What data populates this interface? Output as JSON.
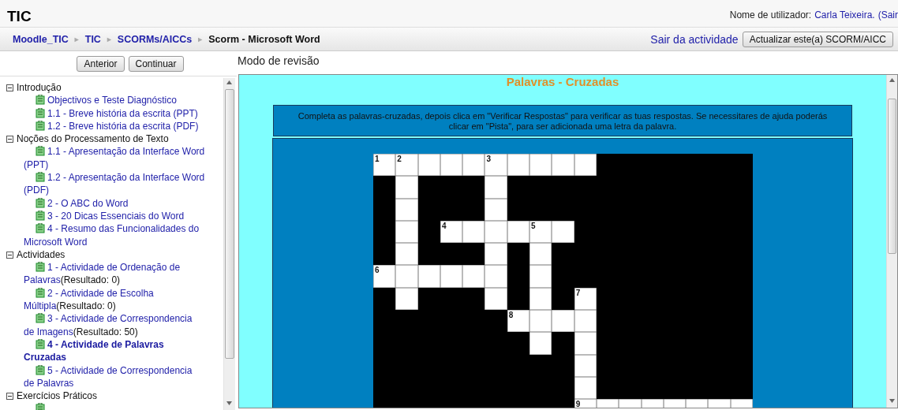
{
  "header": {
    "site_title": "TIC",
    "user_label": "Nome de utilizador:",
    "user_name": "Carla Teixeira.",
    "logout": "(Sair"
  },
  "breadcrumb": [
    {
      "label": "Moodle_TIC",
      "link": true
    },
    {
      "label": "TIC",
      "link": true
    },
    {
      "label": "SCORMs/AICCs",
      "link": true
    },
    {
      "label": "Scorm - Microsoft Word",
      "link": false
    }
  ],
  "breadcrumb_separator": "►",
  "exit_link": "Sair da actividade",
  "update_button": "Actualizar este(a) SCORM/AICC",
  "nav_buttons": [
    "Anterior",
    "Continuar"
  ],
  "mode_label": "Modo de revisão",
  "toc": [
    {
      "title": "Introdução",
      "expanded": true,
      "children": [
        {
          "label": "Objectivos e Teste Diagnóstico",
          "selected": false
        },
        {
          "label": "1.1 - Breve história da escrita (PPT)",
          "selected": false
        },
        {
          "label": "1.2 - Breve história da escrita (PDF)",
          "selected": false
        }
      ]
    },
    {
      "title": "Noções do Processamento de Texto",
      "expanded": true,
      "children": [
        {
          "label": "1.1 - Apresentação da Interface Word (PPT)",
          "selected": false
        },
        {
          "label": "1.2 - Apresentação da Interface Word (PDF)",
          "selected": false
        },
        {
          "label": "2 - O ABC do Word",
          "selected": false
        },
        {
          "label": "3 - 20 Dicas Essenciais do Word",
          "selected": false
        },
        {
          "label": "4 - Resumo das Funcionalidades do Microsoft Word",
          "selected": false
        }
      ]
    },
    {
      "title": "Actividades",
      "expanded": true,
      "children": [
        {
          "label": "1 - Actividade de Ordenação de Palavras",
          "result": "(Resultado: 0)",
          "selected": false
        },
        {
          "label": "2 - Actividade de Escolha Múltipla",
          "result": "(Resultado: 0)",
          "selected": false
        },
        {
          "label": "3 - Actividade de Correspondencia de Imagens",
          "result": "(Resultado: 50)",
          "selected": false
        },
        {
          "label": "4 - Actividade de Palavras Cruzadas",
          "selected": true
        },
        {
          "label": "5 - Actividade de Correspondencia de Palavras",
          "selected": false
        }
      ]
    },
    {
      "title": "Exercícios Práticos",
      "expanded": true,
      "children": [
        {
          "selected": false
        }
      ]
    }
  ],
  "activity": {
    "title": "Palavras - Cruzadas",
    "instructions": "Completa as palavras-cruzadas, depois clica em \"Verificar Respostas\" para verificar as tuas respostas. Se necessitares de ajuda poderás clicar em \"Pista\", para ser adicionada uma letra da palavra.",
    "grid": [
      [
        {
          "kind": "open",
          "number": "1"
        },
        {
          "kind": "open",
          "number": "2"
        },
        {
          "kind": "open"
        },
        {
          "kind": "open"
        },
        {
          "kind": "open"
        },
        {
          "kind": "open",
          "number": "3"
        },
        {
          "kind": "open"
        },
        {
          "kind": "open"
        },
        {
          "kind": "open"
        },
        {
          "kind": "open"
        },
        {
          "kind": "block"
        },
        {
          "kind": "block"
        },
        {
          "kind": "block"
        },
        {
          "kind": "block"
        },
        {
          "kind": "block"
        },
        {
          "kind": "block"
        },
        {
          "kind": "block"
        }
      ],
      [
        {
          "kind": "block"
        },
        {
          "kind": "open"
        },
        {
          "kind": "block"
        },
        {
          "kind": "block"
        },
        {
          "kind": "block"
        },
        {
          "kind": "open"
        },
        {
          "kind": "block"
        },
        {
          "kind": "block"
        },
        {
          "kind": "block"
        },
        {
          "kind": "block"
        },
        {
          "kind": "block"
        },
        {
          "kind": "block"
        },
        {
          "kind": "block"
        },
        {
          "kind": "block"
        },
        {
          "kind": "block"
        },
        {
          "kind": "block"
        },
        {
          "kind": "block"
        }
      ],
      [
        {
          "kind": "block"
        },
        {
          "kind": "open"
        },
        {
          "kind": "block"
        },
        {
          "kind": "block"
        },
        {
          "kind": "block"
        },
        {
          "kind": "open"
        },
        {
          "kind": "block"
        },
        {
          "kind": "block"
        },
        {
          "kind": "block"
        },
        {
          "kind": "block"
        },
        {
          "kind": "block"
        },
        {
          "kind": "block"
        },
        {
          "kind": "block"
        },
        {
          "kind": "block"
        },
        {
          "kind": "block"
        },
        {
          "kind": "block"
        },
        {
          "kind": "block"
        }
      ],
      [
        {
          "kind": "block"
        },
        {
          "kind": "open"
        },
        {
          "kind": "block"
        },
        {
          "kind": "open",
          "number": "4"
        },
        {
          "kind": "open"
        },
        {
          "kind": "open"
        },
        {
          "kind": "open"
        },
        {
          "kind": "open",
          "number": "5"
        },
        {
          "kind": "open"
        },
        {
          "kind": "block"
        },
        {
          "kind": "block"
        },
        {
          "kind": "block"
        },
        {
          "kind": "block"
        },
        {
          "kind": "block"
        },
        {
          "kind": "block"
        },
        {
          "kind": "block"
        },
        {
          "kind": "block"
        }
      ],
      [
        {
          "kind": "block"
        },
        {
          "kind": "open"
        },
        {
          "kind": "block"
        },
        {
          "kind": "block"
        },
        {
          "kind": "block"
        },
        {
          "kind": "open"
        },
        {
          "kind": "block"
        },
        {
          "kind": "open"
        },
        {
          "kind": "block"
        },
        {
          "kind": "block"
        },
        {
          "kind": "block"
        },
        {
          "kind": "block"
        },
        {
          "kind": "block"
        },
        {
          "kind": "block"
        },
        {
          "kind": "block"
        },
        {
          "kind": "block"
        },
        {
          "kind": "block"
        }
      ],
      [
        {
          "kind": "open",
          "number": "6"
        },
        {
          "kind": "open"
        },
        {
          "kind": "open"
        },
        {
          "kind": "open"
        },
        {
          "kind": "open"
        },
        {
          "kind": "open"
        },
        {
          "kind": "block"
        },
        {
          "kind": "open"
        },
        {
          "kind": "block"
        },
        {
          "kind": "block"
        },
        {
          "kind": "block"
        },
        {
          "kind": "block"
        },
        {
          "kind": "block"
        },
        {
          "kind": "block"
        },
        {
          "kind": "block"
        },
        {
          "kind": "block"
        },
        {
          "kind": "block"
        }
      ],
      [
        {
          "kind": "block"
        },
        {
          "kind": "open"
        },
        {
          "kind": "block"
        },
        {
          "kind": "block"
        },
        {
          "kind": "block"
        },
        {
          "kind": "open"
        },
        {
          "kind": "block"
        },
        {
          "kind": "open"
        },
        {
          "kind": "block"
        },
        {
          "kind": "open",
          "number": "7"
        },
        {
          "kind": "block"
        },
        {
          "kind": "block"
        },
        {
          "kind": "block"
        },
        {
          "kind": "block"
        },
        {
          "kind": "block"
        },
        {
          "kind": "block"
        },
        {
          "kind": "block"
        }
      ],
      [
        {
          "kind": "block"
        },
        {
          "kind": "block"
        },
        {
          "kind": "block"
        },
        {
          "kind": "block"
        },
        {
          "kind": "block"
        },
        {
          "kind": "block"
        },
        {
          "kind": "open",
          "number": "8"
        },
        {
          "kind": "open"
        },
        {
          "kind": "open"
        },
        {
          "kind": "open"
        },
        {
          "kind": "block"
        },
        {
          "kind": "block"
        },
        {
          "kind": "block"
        },
        {
          "kind": "block"
        },
        {
          "kind": "block"
        },
        {
          "kind": "block"
        },
        {
          "kind": "block"
        }
      ],
      [
        {
          "kind": "block"
        },
        {
          "kind": "block"
        },
        {
          "kind": "block"
        },
        {
          "kind": "block"
        },
        {
          "kind": "block"
        },
        {
          "kind": "block"
        },
        {
          "kind": "block"
        },
        {
          "kind": "open"
        },
        {
          "kind": "block"
        },
        {
          "kind": "open"
        },
        {
          "kind": "block"
        },
        {
          "kind": "block"
        },
        {
          "kind": "block"
        },
        {
          "kind": "block"
        },
        {
          "kind": "block"
        },
        {
          "kind": "block"
        },
        {
          "kind": "block"
        }
      ],
      [
        {
          "kind": "block"
        },
        {
          "kind": "block"
        },
        {
          "kind": "block"
        },
        {
          "kind": "block"
        },
        {
          "kind": "block"
        },
        {
          "kind": "block"
        },
        {
          "kind": "block"
        },
        {
          "kind": "block"
        },
        {
          "kind": "block"
        },
        {
          "kind": "open"
        },
        {
          "kind": "block"
        },
        {
          "kind": "block"
        },
        {
          "kind": "block"
        },
        {
          "kind": "block"
        },
        {
          "kind": "block"
        },
        {
          "kind": "block"
        },
        {
          "kind": "block"
        }
      ],
      [
        {
          "kind": "block"
        },
        {
          "kind": "block"
        },
        {
          "kind": "block"
        },
        {
          "kind": "block"
        },
        {
          "kind": "block"
        },
        {
          "kind": "block"
        },
        {
          "kind": "block"
        },
        {
          "kind": "block"
        },
        {
          "kind": "block"
        },
        {
          "kind": "open"
        },
        {
          "kind": "block"
        },
        {
          "kind": "block"
        },
        {
          "kind": "block"
        },
        {
          "kind": "block"
        },
        {
          "kind": "block"
        },
        {
          "kind": "block"
        },
        {
          "kind": "block"
        }
      ],
      [
        {
          "kind": "block"
        },
        {
          "kind": "block"
        },
        {
          "kind": "block"
        },
        {
          "kind": "block"
        },
        {
          "kind": "block"
        },
        {
          "kind": "block"
        },
        {
          "kind": "block"
        },
        {
          "kind": "block"
        },
        {
          "kind": "block"
        },
        {
          "kind": "open",
          "number": "9"
        },
        {
          "kind": "open"
        },
        {
          "kind": "open"
        },
        {
          "kind": "open"
        },
        {
          "kind": "open"
        },
        {
          "kind": "open"
        },
        {
          "kind": "open"
        },
        {
          "kind": "open"
        }
      ]
    ]
  }
}
